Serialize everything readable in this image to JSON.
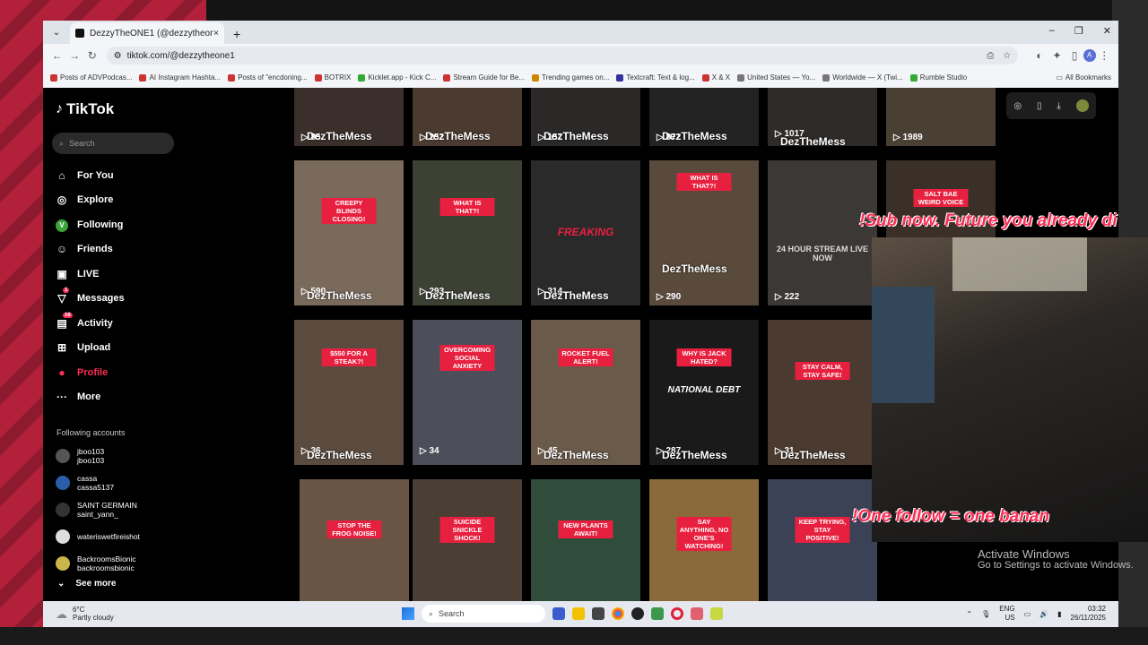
{
  "browser": {
    "tab_title": "DezzyTheONE1 (@dezzytheone1)",
    "new_tab": "+",
    "url": "tiktok.com/@dezzytheone1",
    "bookmarks": [
      "Posts of ADVPodcas...",
      "AI Instagram Hashta...",
      "Posts of \"encdoning...",
      "BOTRIX",
      "Kicklet.app - Kick C...",
      "Stream Guide for Be...",
      "Trending games on...",
      "Textcraft: Text & log...",
      "X & X",
      "United States — Yo...",
      "Worldwide — X (Twi...",
      "Rumble Studio"
    ],
    "all_bookmarks": "All Bookmarks",
    "profile_initial": "A"
  },
  "tiktok": {
    "logo": "TikTok",
    "search_placeholder": "Search",
    "nav": [
      {
        "label": "For You",
        "icon": "home-icon",
        "glyph": "⌂"
      },
      {
        "label": "Explore",
        "icon": "compass-icon",
        "glyph": "◎"
      },
      {
        "label": "Following",
        "icon": "following-icon",
        "glyph": "V"
      },
      {
        "label": "Friends",
        "icon": "friends-icon",
        "glyph": "☺"
      },
      {
        "label": "LIVE",
        "icon": "live-icon",
        "glyph": "▣"
      },
      {
        "label": "Messages",
        "icon": "messages-icon",
        "glyph": "▽",
        "badge": "1"
      },
      {
        "label": "Activity",
        "icon": "activity-icon",
        "glyph": "▤",
        "badge": "16"
      },
      {
        "label": "Upload",
        "icon": "upload-icon",
        "glyph": "⊞"
      },
      {
        "label": "Profile",
        "icon": "profile-icon",
        "glyph": "●"
      },
      {
        "label": "More",
        "icon": "more-icon",
        "glyph": "···"
      }
    ],
    "following_title": "Following accounts",
    "accounts": [
      {
        "name": "jboo103",
        "handle": "jboo103"
      },
      {
        "name": "cassa",
        "handle": "cassa5137"
      },
      {
        "name": "SAINT GERMAIN",
        "handle": "saint_yann_"
      },
      {
        "name": "wateriswetfireishot",
        "handle": ""
      },
      {
        "name": "BackroomsBionic",
        "handle": "backroomsbionic"
      }
    ],
    "see_more": "See more"
  },
  "videos": [
    {
      "caption": "",
      "views": "85",
      "watermark": "DezTheMess"
    },
    {
      "caption": "",
      "views": "252",
      "watermark": "DezTheMess"
    },
    {
      "caption": "",
      "views": "157",
      "watermark": "DezTheMess"
    },
    {
      "caption": "",
      "views": "872",
      "watermark": "DezTheMess"
    },
    {
      "caption": "",
      "views": "1017",
      "watermark": "DezTheMess"
    },
    {
      "caption": "",
      "views": "1989",
      "watermark": ""
    },
    {
      "caption": "CREEPY BLINDS CLOSING!",
      "views": "590",
      "watermark": "DezTheMess"
    },
    {
      "caption": "WHAT IS THAT?!",
      "views": "293",
      "watermark": "DezTheMess"
    },
    {
      "caption": "",
      "views": "314",
      "watermark": "DezTheMess",
      "mid": "FREAKING"
    },
    {
      "caption": "WHAT IS THAT?!",
      "views": "290",
      "watermark": "DezTheMess"
    },
    {
      "caption": "",
      "views": "222",
      "watermark": "",
      "mid": "24 HOUR STREAM LIVE NOW"
    },
    {
      "caption": "SALT BAE WEIRD VOICE",
      "views": "",
      "watermark": ""
    },
    {
      "caption": "$550 FOR A STEAK?!",
      "views": "36",
      "watermark": "DezTheMess"
    },
    {
      "caption": "OVERCOMING SOCIAL ANXIETY",
      "views": "34",
      "watermark": ""
    },
    {
      "caption": "ROCKET FUEL ALERT!",
      "views": "45",
      "watermark": "DezTheMess"
    },
    {
      "caption": "WHY IS JACK HATED?",
      "views": "287",
      "watermark": "DezTheMess",
      "mid": "NATIONAL DEBT"
    },
    {
      "caption": "STAY CALM, STAY SAFE!",
      "views": "31",
      "watermark": "DezTheMess"
    },
    {
      "caption": "STOP THE FROG NOISE!",
      "views": "",
      "watermark": ""
    },
    {
      "caption": "SUICIDE SNICKLE SHOCK!",
      "views": "",
      "watermark": ""
    },
    {
      "caption": "NEW PLANTS AWAIT!",
      "views": "",
      "watermark": ""
    },
    {
      "caption": "SAY ANYTHING, NO ONE'S WATCHING!",
      "views": "",
      "watermark": ""
    },
    {
      "caption": "KEEP TRYING, STAY POSITIVE!",
      "views": "",
      "watermark": ""
    }
  ],
  "overlay": {
    "top_text": "!Sub now. Future you already di",
    "bottom_text": "!One follow = one banan",
    "activate_1": "Activate Windows",
    "activate_2": "Go to Settings to activate Windows."
  },
  "taskbar": {
    "temp": "6°C",
    "weather": "Partly cloudy",
    "search": "Search",
    "lang": "ENG",
    "region": "US",
    "time": "03:32",
    "date": "26/11/2025"
  },
  "colors": {
    "accent": "#fe2c55",
    "caption_bg": "#e8203f"
  }
}
